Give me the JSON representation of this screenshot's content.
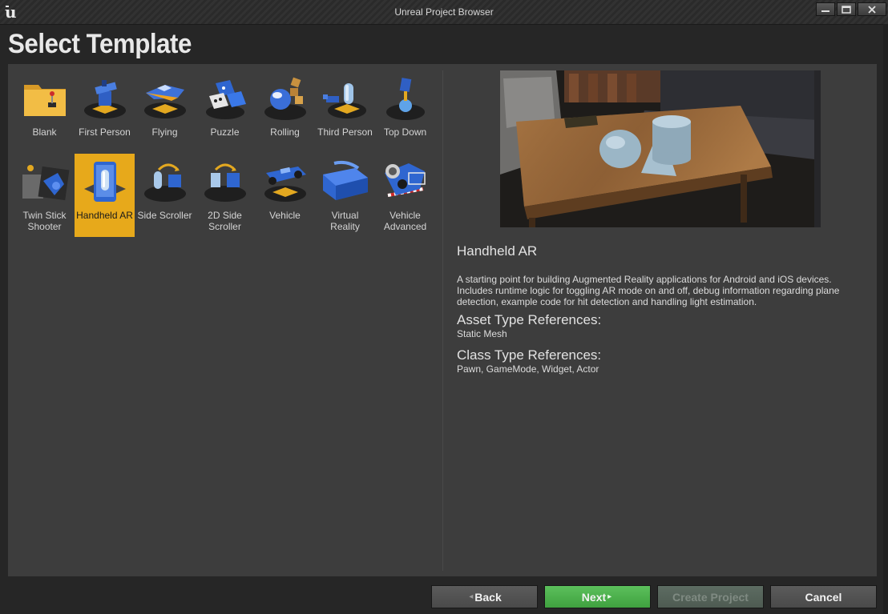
{
  "window": {
    "title": "Unreal Project Browser",
    "app_icon": "unreal-logo"
  },
  "heading": "Select Template",
  "templates": [
    {
      "label": "Blank",
      "icon": "folder-joystick"
    },
    {
      "label": "First Person",
      "icon": "gun-turret"
    },
    {
      "label": "Flying",
      "icon": "spaceship"
    },
    {
      "label": "Puzzle",
      "icon": "puzzle-blocks"
    },
    {
      "label": "Rolling",
      "icon": "rolling-ball"
    },
    {
      "label": "Third Person",
      "icon": "capsule-character"
    },
    {
      "label": "Top Down",
      "icon": "top-down-character"
    },
    {
      "label": "Twin Stick Shooter",
      "icon": "twin-stick-ship"
    },
    {
      "label": "Handheld AR",
      "icon": "phone-ar",
      "selected": true
    },
    {
      "label": "Side Scroller",
      "icon": "side-scroller"
    },
    {
      "label": "2D Side Scroller",
      "icon": "2d-side-scroller"
    },
    {
      "label": "Vehicle",
      "icon": "vehicle-car"
    },
    {
      "label": "Virtual Reality",
      "icon": "vr-headset"
    },
    {
      "label": "Vehicle Advanced",
      "icon": "vehicle-advanced"
    }
  ],
  "selected": {
    "name": "Handheld AR",
    "description": "A starting point for building Augmented Reality applications for Android and iOS devices. Includes runtime logic for toggling AR mode on and off, debug information regarding plane detection, example code for hit detection and handling light estimation.",
    "asset_refs_heading": "Asset Type References:",
    "asset_refs": "Static Mesh",
    "class_refs_heading": "Class Type References:",
    "class_refs": "Pawn, GameMode, Widget, Actor"
  },
  "buttons": {
    "back": "Back",
    "next": "Next",
    "create": "Create Project",
    "cancel": "Cancel"
  },
  "colors": {
    "selection": "#e7a91b",
    "next_button": "#4caf4c",
    "panel": "#3d3d3d",
    "background": "#262626"
  }
}
